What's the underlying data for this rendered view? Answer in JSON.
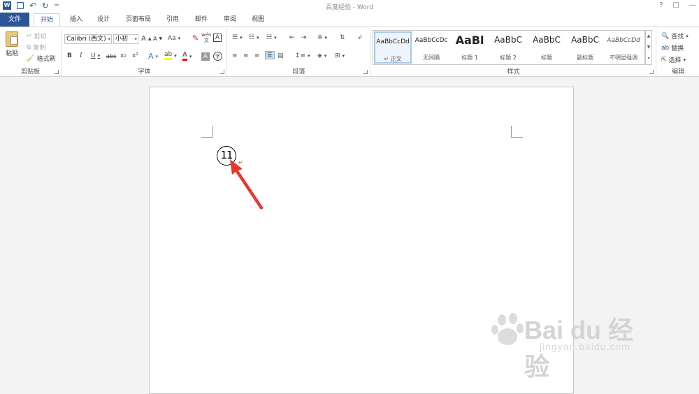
{
  "window": {
    "title": "百度经验 - Word",
    "help": "?",
    "restore": "□",
    "minimize": "—"
  },
  "qat": {
    "word_icon": "W",
    "save_icon": "💾",
    "undo_icon": "↶",
    "redo_icon": "↻",
    "customize_icon": "="
  },
  "tabs": [
    {
      "label": "文件"
    },
    {
      "label": "开始"
    },
    {
      "label": "插入"
    },
    {
      "label": "设计"
    },
    {
      "label": "页面布局"
    },
    {
      "label": "引用"
    },
    {
      "label": "邮件"
    },
    {
      "label": "审阅"
    },
    {
      "label": "视图"
    }
  ],
  "clipboard": {
    "label": "剪贴板",
    "paste": "粘贴",
    "cut": "剪切",
    "copy": "复制",
    "format_painter": "格式刷"
  },
  "font": {
    "label": "字体",
    "font_name": "Calibri (西文)",
    "font_size": "小初",
    "bold": "B",
    "italic": "I",
    "underline": "U",
    "strike": "abc",
    "subscript": "x₂",
    "superscript": "x²",
    "grow": "A",
    "shrink": "A",
    "change_case": "Aa",
    "clear_format": "A",
    "phonetic": "wén",
    "border_char": "A",
    "font_color": "A",
    "shading": "A",
    "enclosed": "字"
  },
  "paragraph": {
    "label": "段落"
  },
  "styles": {
    "label": "样式",
    "items": [
      {
        "sample": "AaBbCcDd",
        "name": "↵ 正文"
      },
      {
        "sample": "AaBbCcDc",
        "name": "无间隔"
      },
      {
        "sample": "AaBl",
        "name": "标题 1"
      },
      {
        "sample": "AaBbC",
        "name": "标题 2"
      },
      {
        "sample": "AaBbC",
        "name": "标题"
      },
      {
        "sample": "AaBbC",
        "name": "副标题"
      },
      {
        "sample": "AaBbCcDd",
        "name": "不明显强调"
      }
    ]
  },
  "editing": {
    "label": "编辑",
    "find": "查找",
    "replace": "替换",
    "select": "选择"
  },
  "document": {
    "enclosed_text": "11",
    "paragraph_mark": "↵"
  },
  "watermark": {
    "brand": "Bai du 经验",
    "url": "jingyan.baidu.com"
  },
  "colors": {
    "accent": "#2b579a",
    "arrow": "#e8372c",
    "highlight": "#ffff00",
    "font_color": "#ff0000"
  }
}
